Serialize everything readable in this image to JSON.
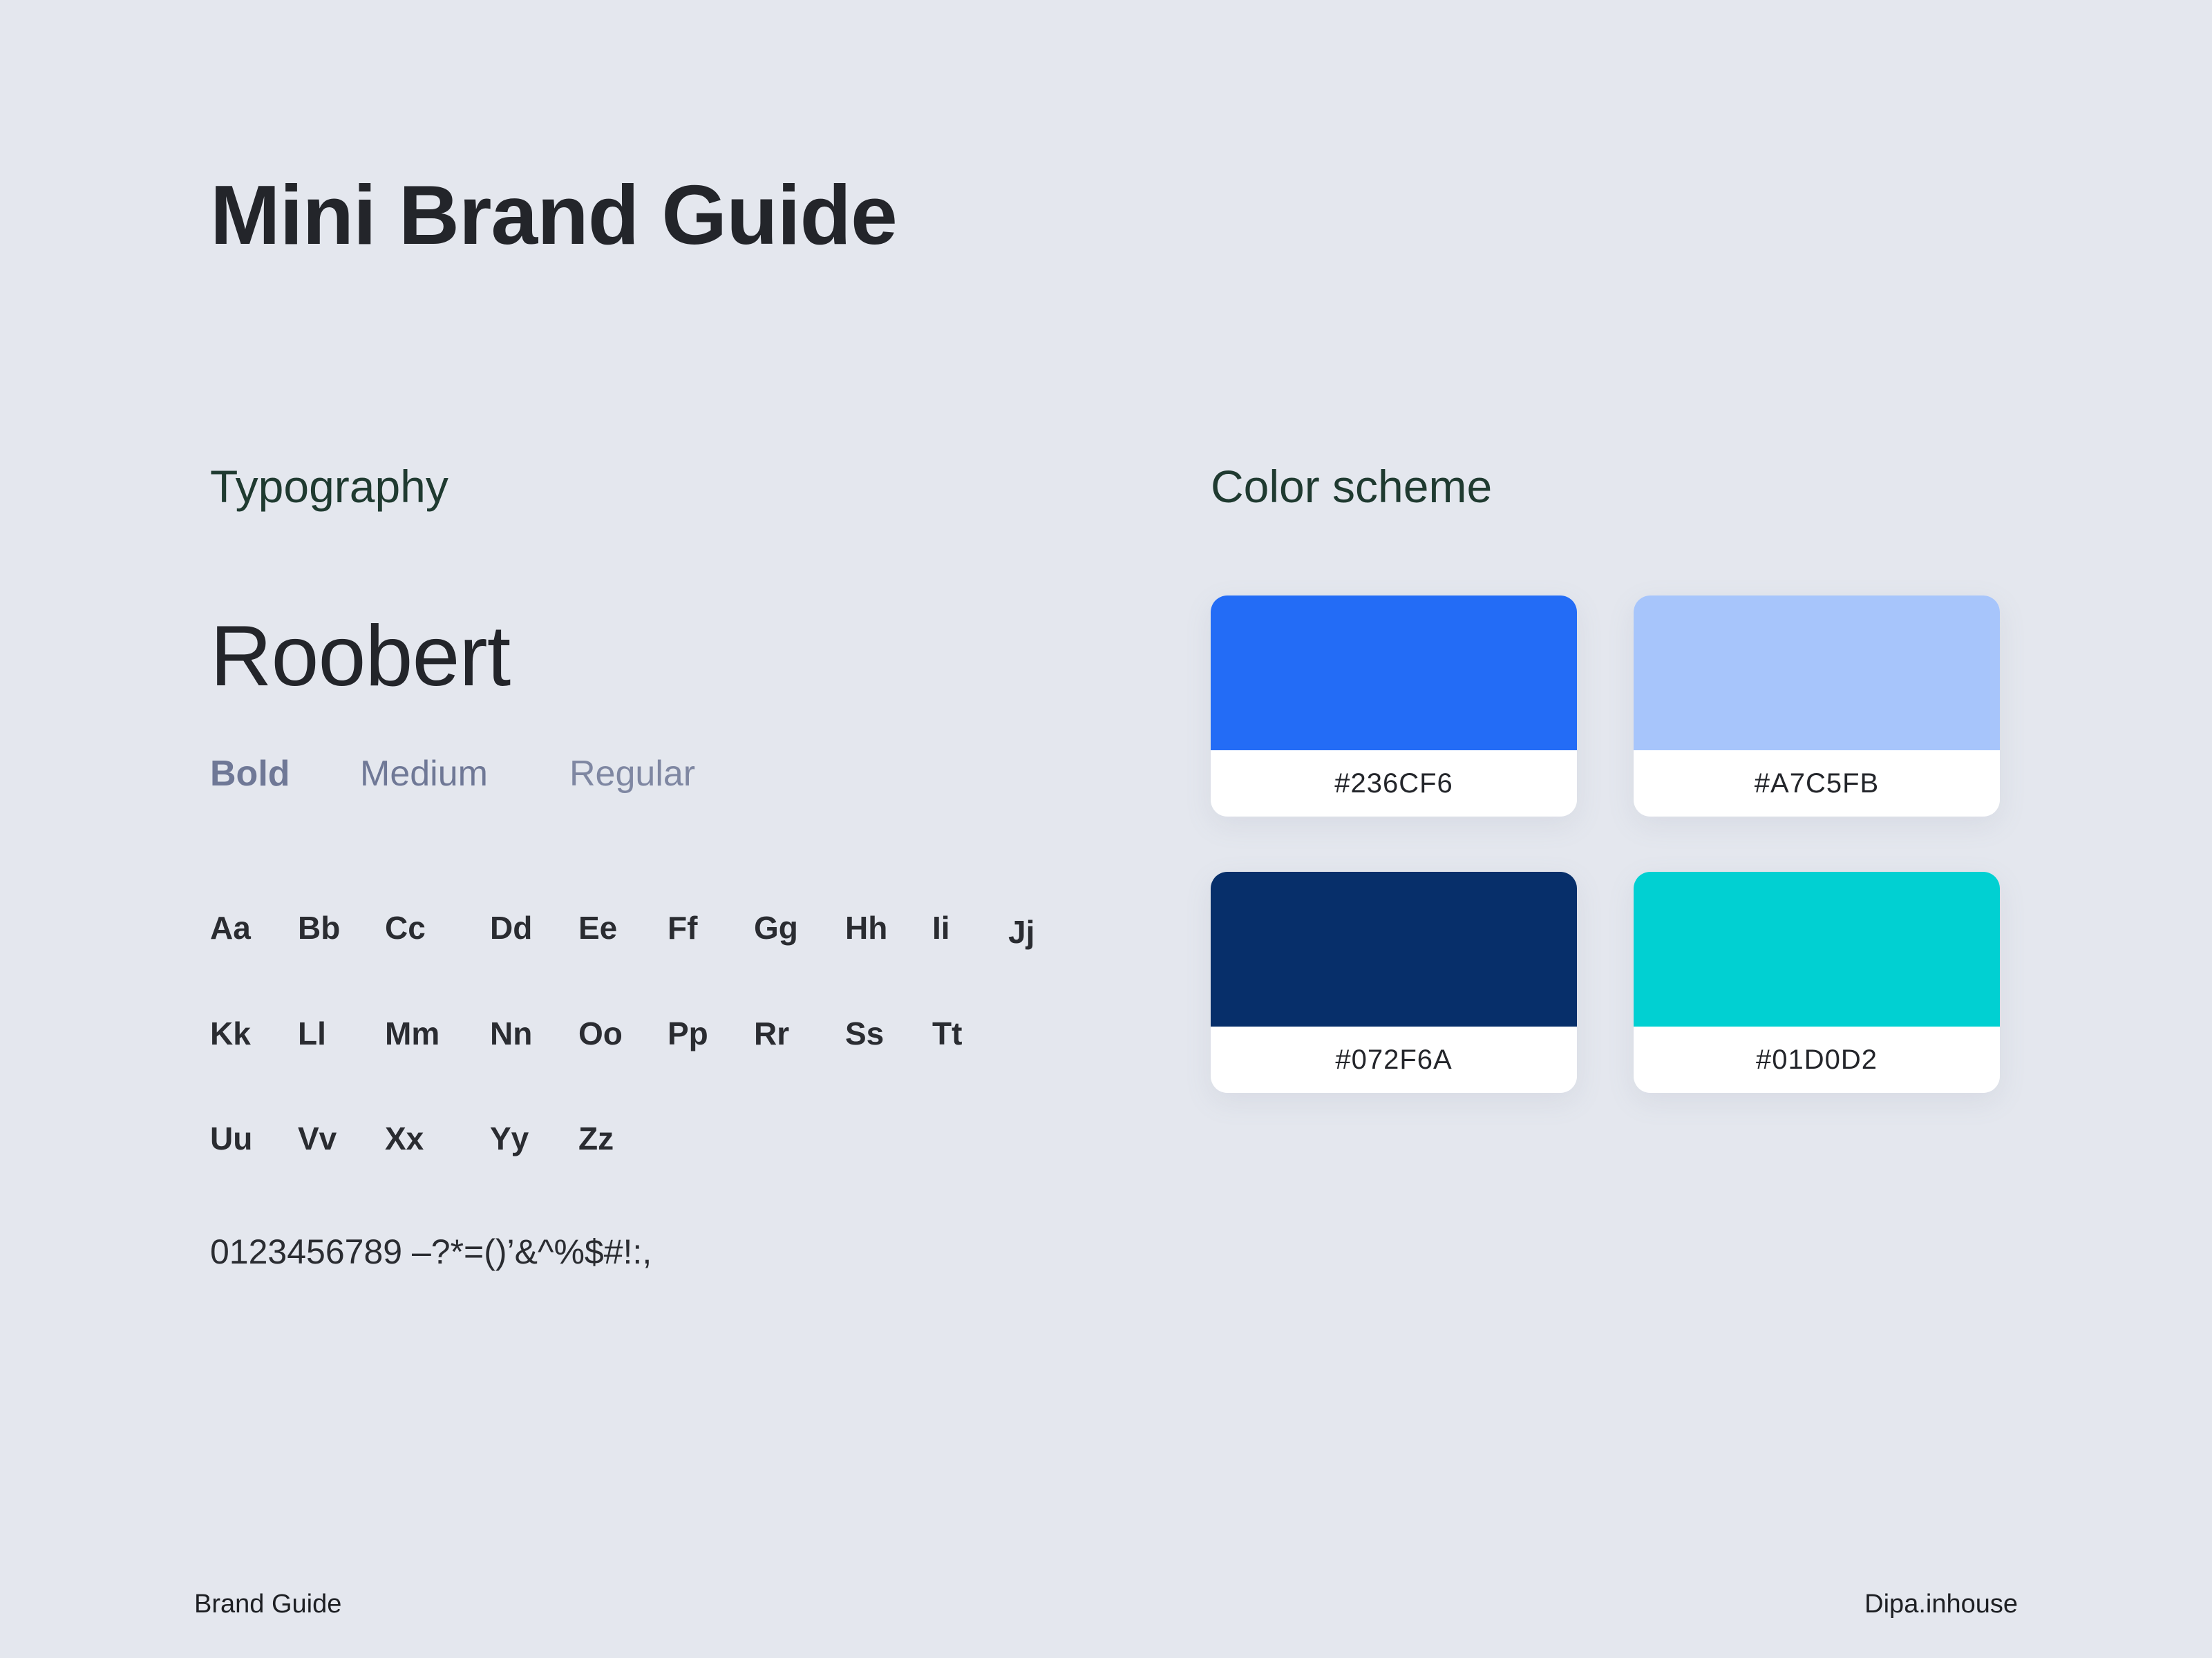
{
  "title": "Mini Brand Guide",
  "typography": {
    "heading": "Typography",
    "font_name": "Roobert",
    "weights": [
      "Bold",
      "Medium",
      "Regular"
    ],
    "alphabet_rows": [
      [
        "Aa",
        "Bb",
        "Cc",
        "Dd",
        "Ee",
        "Ff",
        "Gg",
        "Hh",
        "Ii",
        "Jj"
      ],
      [
        "Kk",
        "Ll",
        "Mm",
        "Nn",
        "Oo",
        "Pp",
        "Rr",
        "Ss",
        "Tt"
      ],
      [
        "Uu",
        "Vv",
        "Xx",
        "Yy",
        "Zz"
      ]
    ],
    "numerals": "0123456789 –?*=()’&^%$#!:,"
  },
  "color_scheme": {
    "heading": "Color scheme",
    "swatches": [
      {
        "hex": "#236CF6",
        "color": "#236CF6"
      },
      {
        "hex": "#A7C5FB",
        "color": "#A7C5FB"
      },
      {
        "hex": "#072F6A",
        "color": "#072F6A"
      },
      {
        "hex": "#01D0D2",
        "color": "#01D0D2"
      }
    ]
  },
  "footer": {
    "left": "Brand Guide",
    "right": "Dipa.inhouse"
  }
}
